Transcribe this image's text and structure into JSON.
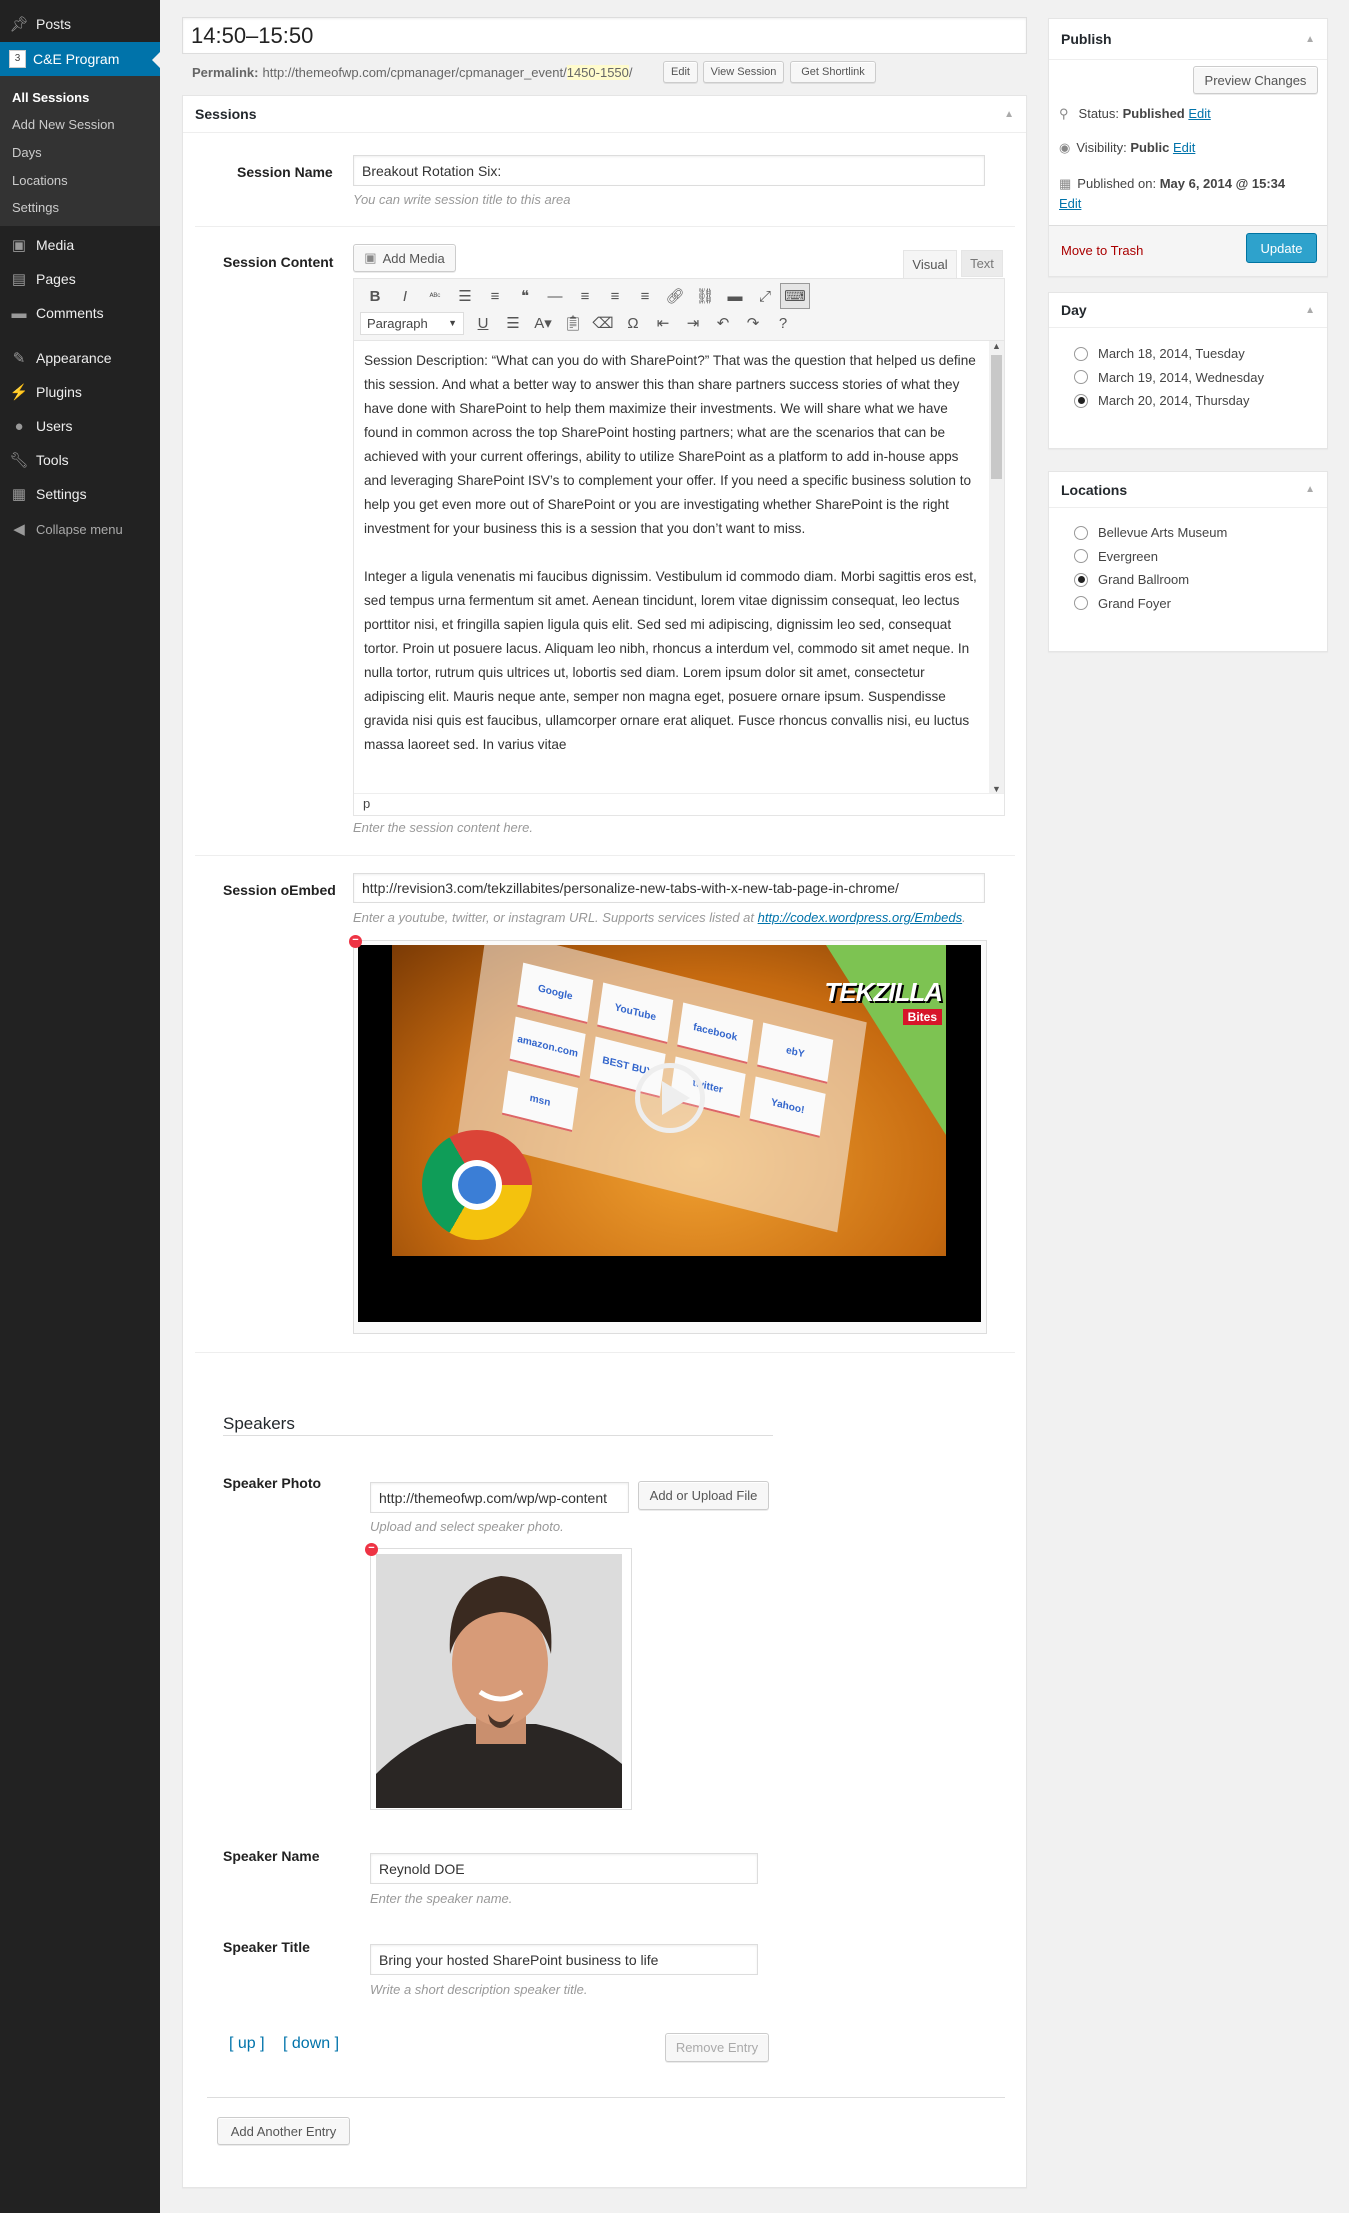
{
  "sidebar": {
    "top_item": {
      "label": "Posts",
      "icon": "pin-icon"
    },
    "current": {
      "label": "C&E Program",
      "icon": "calendar-icon",
      "badge": "3"
    },
    "submenu": [
      {
        "label": "All Sessions",
        "active": true
      },
      {
        "label": "Add New Session"
      },
      {
        "label": "Days"
      },
      {
        "label": "Locations"
      },
      {
        "label": "Settings"
      }
    ],
    "items": [
      {
        "label": "Media",
        "icon": "media-icon"
      },
      {
        "label": "Pages",
        "icon": "pages-icon"
      },
      {
        "label": "Comments",
        "icon": "comment-icon"
      },
      {
        "label": "Appearance",
        "icon": "brush-icon"
      },
      {
        "label": "Plugins",
        "icon": "plug-icon"
      },
      {
        "label": "Users",
        "icon": "user-icon"
      },
      {
        "label": "Tools",
        "icon": "wrench-icon"
      },
      {
        "label": "Settings",
        "icon": "sliders-icon"
      }
    ],
    "collapse": "Collapse menu"
  },
  "post": {
    "title": "14:50–15:50",
    "permalink_label": "Permalink:",
    "permalink_base": "http://themeofwp.com/cpmanager/cpmanager_event/",
    "permalink_slug": "1450-1550",
    "permalink_end": "/",
    "edit": "Edit",
    "view": "View Session",
    "shortlink": "Get Shortlink"
  },
  "sessions": {
    "title": "Sessions",
    "name_label": "Session Name",
    "name_value": "Breakout Rotation Six:",
    "name_hint": "You can write session title to this area",
    "content_label": "Session Content",
    "add_media": "Add Media",
    "tab_visual": "Visual",
    "tab_text": "Text",
    "format_select": "Paragraph",
    "toolbar_row1": [
      "bold-icon",
      "italic-icon",
      "strikethrough-icon",
      "bullet-list-icon",
      "numbered-list-icon",
      "blockquote-icon",
      "horizontal-rule-icon",
      "align-left-icon",
      "align-center-icon",
      "align-right-icon",
      "link-icon",
      "unlink-icon",
      "read-more-icon",
      "fullscreen-icon",
      "toolbar-toggle-icon"
    ],
    "toolbar_row2": [
      "underline-icon",
      "justify-icon",
      "text-color-icon",
      "paste-text-icon",
      "clear-format-icon",
      "special-char-icon",
      "outdent-icon",
      "indent-icon",
      "undo-icon",
      "redo-icon",
      "help-icon"
    ],
    "content_p1": "Session Description: “What can you do with SharePoint?” That was the question that helped us define this session. And what a better way to answer this than share partners success stories of what they have done with SharePoint to help them maximize their investments. We will share what we have found in common across the top SharePoint hosting partners; what are the scenarios that can be achieved with your current offerings, ability to utilize SharePoint as a platform to add in-house apps and leveraging SharePoint ISV’s to complement your offer. If you need a specific business solution to help you get even more out of SharePoint or you are investigating whether SharePoint is the right investment for your business this is a session that you don’t want to miss.",
    "content_p2": "Integer a ligula venenatis mi faucibus dignissim. Vestibulum id commodo diam. Morbi sagittis eros est, sed tempus urna fermentum sit amet. Aenean tincidunt, lorem vitae dignissim consequat, leo lectus porttitor nisi, et fringilla sapien ligula quis elit. Sed sed mi adipiscing, dignissim leo sed, consequat tortor. Proin ut posuere lacus. Aliquam leo nibh, rhoncus a interdum vel, commodo sit amet neque. In nulla tortor, rutrum quis ultrices ut, lobortis sed diam. Lorem ipsum dolor sit amet, consectetur adipiscing elit. Mauris neque ante, semper non magna eget, posuere ornare ipsum. Suspendisse gravida nisi quis est faucibus, ullamcorper ornare erat aliquet. Fusce rhoncus convallis nisi, eu luctus massa laoreet sed. In varius vitae",
    "path": "p",
    "content_hint": "Enter the session content here.",
    "oembed_label": "Session oEmbed",
    "oembed_value": "http://revision3.com/tekzillabites/personalize-new-tabs-with-x-new-tab-page-in-chrome/",
    "oembed_hint": "Enter a youtube, twitter, or instagram URL. Supports services listed at ",
    "oembed_link": "http://codex.wordpress.org/Embeds",
    "oembed_hint_end": ".",
    "video_logo": "TEKZILLA",
    "video_logo_sub": "Bites",
    "video_tiles": [
      "Google",
      "YouTube",
      "facebook",
      "ebY",
      "amazon.com",
      "BEST BUY",
      "twitter",
      "Yahoo!",
      "msn"
    ]
  },
  "speakers": {
    "heading": "Speakers",
    "photo_label": "Speaker Photo",
    "photo_value": "http://themeofwp.com/wp/wp-content",
    "upload_button": "Add or Upload File",
    "photo_hint": "Upload and select speaker photo.",
    "name_label": "Speaker Name",
    "name_value": "Reynold DOE",
    "name_hint": "Enter the speaker name.",
    "title_label": "Speaker Title",
    "title_value": "Bring your hosted SharePoint business to life",
    "title_hint": "Write a short description speaker title.",
    "up": "[ up ]",
    "down": "[ down ]",
    "remove": "Remove Entry",
    "add_another": "Add Another Entry"
  },
  "publish": {
    "title": "Publish",
    "preview": "Preview Changes",
    "status_label": "Status:",
    "status_value": "Published",
    "visibility_label": "Visibility:",
    "visibility_value": "Public",
    "published_label": "Published on:",
    "published_value": "May 6, 2014 @ 15:34",
    "edit": "Edit",
    "trash": "Move to Trash",
    "update": "Update"
  },
  "day": {
    "title": "Day",
    "options": [
      {
        "label": "March 18, 2014, Tuesday",
        "checked": false
      },
      {
        "label": "March 19, 2014, Wednesday",
        "checked": false
      },
      {
        "label": "March 20, 2014, Thursday",
        "checked": true
      }
    ]
  },
  "locations": {
    "title": "Locations",
    "options": [
      {
        "label": "Bellevue Arts Museum",
        "checked": false
      },
      {
        "label": "Evergreen",
        "checked": false
      },
      {
        "label": "Grand Ballroom",
        "checked": true
      },
      {
        "label": "Grand Foyer",
        "checked": false
      }
    ]
  },
  "colors": {
    "accent": "#0073aa",
    "sidebar": "#222222",
    "update_button": "#2ea2cc",
    "trash": "#a00000",
    "slug_highlight": "#fffbcc"
  }
}
